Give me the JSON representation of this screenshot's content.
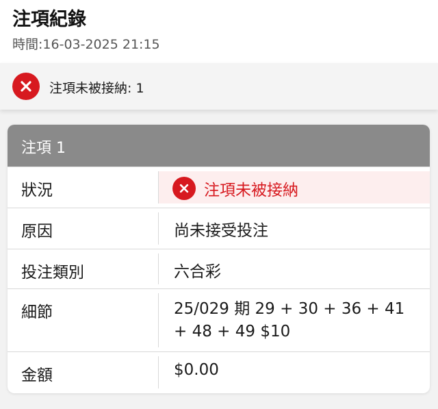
{
  "header": {
    "title": "注項紀錄",
    "time_label": "時間:",
    "time_value": "16-03-2025 21:15"
  },
  "summary": {
    "icon": "error-x-icon",
    "text": "注項未被接納: 1"
  },
  "card": {
    "title": "注項 1",
    "rows": [
      {
        "label": "狀況",
        "value": "注項未被接納",
        "icon": "error-x-icon"
      },
      {
        "label": "原因",
        "value": "尚未接受投注"
      },
      {
        "label": "投注類別",
        "value": "六合彩"
      },
      {
        "label": "細節",
        "value_line1": "25/029 期 29 + 30 + 36 + 41",
        "value_line2": "+ 48 + 49 $10"
      },
      {
        "label": "金額",
        "value": "$0.00"
      }
    ]
  },
  "colors": {
    "error_red": "#d7191f",
    "status_bg": "#fdeeee",
    "card_header_bg": "#8a8a8a"
  }
}
